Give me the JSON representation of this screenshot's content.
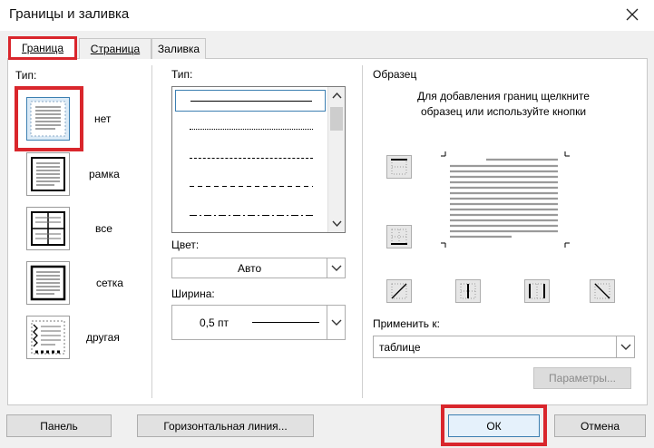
{
  "window": {
    "title": "Границы и заливка"
  },
  "tabs": [
    {
      "label": "Граница",
      "active": true
    },
    {
      "label": "Страница",
      "active": false
    },
    {
      "label": "Заливка",
      "active": false
    }
  ],
  "type_section": {
    "label": "Тип:",
    "presets": [
      {
        "label": "нет",
        "icon": "no-border-preset-icon",
        "selected": true
      },
      {
        "label": "рамка",
        "icon": "box-preset-icon",
        "selected": false
      },
      {
        "label": "все",
        "icon": "all-borders-preset-icon",
        "selected": false
      },
      {
        "label": "сетка",
        "icon": "grid-preset-icon",
        "selected": false
      },
      {
        "label": "другая",
        "icon": "custom-preset-icon",
        "selected": false
      }
    ]
  },
  "style_section": {
    "label": "Тип:",
    "line_styles": [
      "solid",
      "dotted",
      "dashed-small",
      "dashed",
      "dash-dot"
    ],
    "color_label": "Цвет:",
    "color_value": "Авто",
    "width_label": "Ширина:",
    "width_value": "0,5 пт"
  },
  "preview": {
    "label": "Образец",
    "hint": "Для добавления границ щелкните образец или используйте кнопки",
    "apply_label": "Применить к:",
    "apply_value": "таблице",
    "options_button": "Параметры..."
  },
  "buttons": {
    "panel": "Панель",
    "horizontal_line": "Горизонтальная линия...",
    "ok": "ОК",
    "cancel": "Отмена"
  },
  "colors": {
    "accent_red": "#d9262c",
    "selection_blue": "#3c7fb1"
  }
}
